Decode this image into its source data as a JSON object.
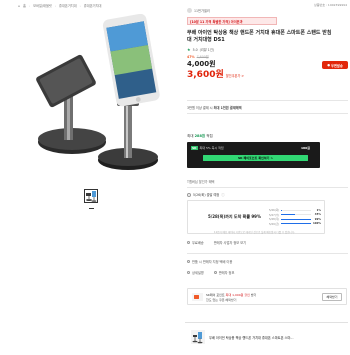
{
  "breadcrumb": {
    "items": [
      "홈",
      "모바일/태블릿",
      "휴대폰거치대",
      "휴대폰거치대"
    ]
  },
  "product_no": "상품번호 : 1902399994",
  "seller": {
    "name": "11번가셀러"
  },
  "promo": {
    "text": "[10분 11 가격 특별한 가격] 아이폰과"
  },
  "title": "무배 아이언 탁상용 책상 핸드폰 거치대 휴대폰 스마트폰 스탠드 받침대 거치대형 DS1",
  "rating": {
    "score": "5.0",
    "count": "(리뷰 1건)"
  },
  "price": {
    "discount_rate": "47%",
    "original": "7,600원",
    "current": "4,000원",
    "sale": "3,600원",
    "sale_label": "할인쿠폰가 >"
  },
  "buy_button": {
    "label": "우편발송"
  },
  "notice": {
    "prefix": "3만원 이상 결제 시",
    "bold": "최대 1천원 결제혜택"
  },
  "benefit": {
    "heading_prefix": "최대",
    "heading_value": "288원",
    "heading_suffix": "적립",
    "row_tag": "SK",
    "row_text": "최대 5% 즉시 적립",
    "row_amount": "180원",
    "button_label": "SK 페이포인트 확인하기 >"
  },
  "employee_note": "T멤버십 할인가 혜택",
  "shipping_tab": "5/26(화) 출발 예정",
  "delivery": {
    "headline": "5/28(목)까지 도착 확률 99%",
    "bars": [
      {
        "label": "5/26(화)",
        "pct": "1%",
        "value": 0.01
      },
      {
        "label": "5/27(수)",
        "pct": "45%",
        "value": 0.45
      },
      {
        "label": "5/28(목)",
        "pct": "99%",
        "value": 0.99
      },
      {
        "label": "5/29(금)",
        "pct": "100%",
        "value": 1.0
      }
    ],
    "footnote": "11번가 배송 데이터 기반으로 예측된 것으로 실제 배송일과 다를 수 있습니다."
  },
  "subtabs": {
    "shipping": "무료배송",
    "reviews": "판매자 사업자 정보 보기"
  },
  "return_line": "반품 시 판매자 지정 택배 이용",
  "dropdowns": {
    "options": "상세설명",
    "seller": "판매자 정보"
  },
  "pay": {
    "prefix": "SK페이 포인트",
    "highlight": "최대 1,000원 할인",
    "suffix": " 받기",
    "sub": "한도 없는 쿠폰 혜택받기",
    "button": "혜택받기"
  },
  "bottom_item": "무배 아이언 탁상용 책상 핸드폰 거치대 휴대폰 스마트폰 스마..."
}
